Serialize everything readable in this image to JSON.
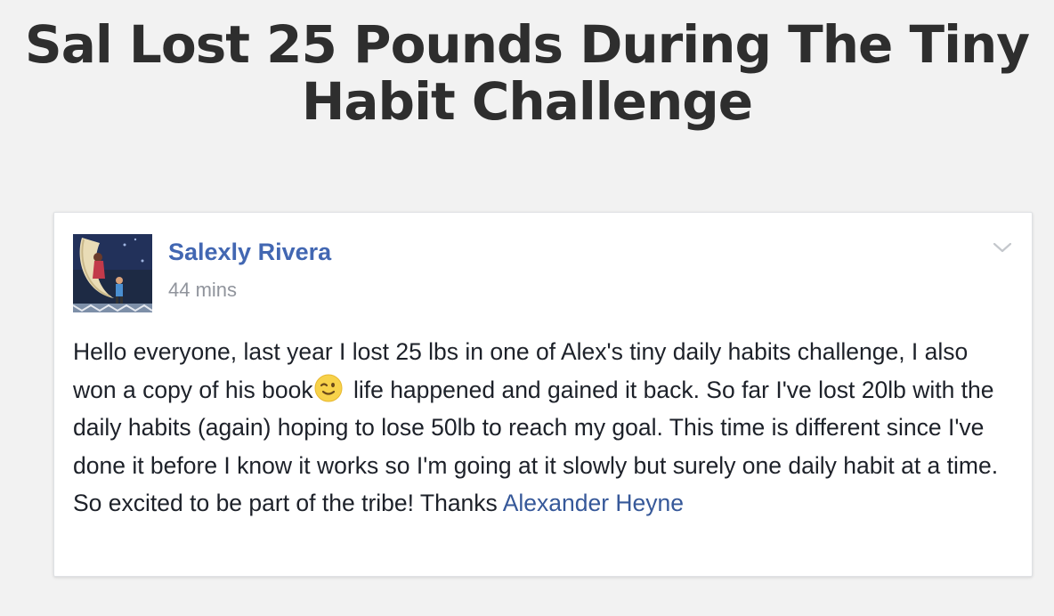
{
  "page": {
    "title": "Sal Lost 25 Pounds During The Tiny Habit Challenge"
  },
  "post": {
    "author": "Salexly Rivera",
    "timestamp": "44 mins",
    "menu_icon": "chevron-down-icon",
    "body_part1": "Hello everyone, last year I lost 25 lbs in one of Alex's tiny daily habits challenge, I also won a copy of his book",
    "emoji": "winking-face-emoji",
    "body_part2": " life happened and gained it back. So far I've lost 20lb with the daily habits (again) hoping to lose 50lb to reach my goal. This time is different since I've done it before I know it works so I'm going at it slowly but surely one daily habit at a time. So excited to be part of the tribe! Thanks ",
    "mention": "Alexander Heyne"
  },
  "colors": {
    "page_background": "#f2f2f2",
    "title_text": "#2e2e2e",
    "card_background": "#ffffff",
    "author_link": "#4267b2",
    "mention_link": "#365899",
    "timestamp_text": "#90949c",
    "body_text": "#1d2129"
  }
}
